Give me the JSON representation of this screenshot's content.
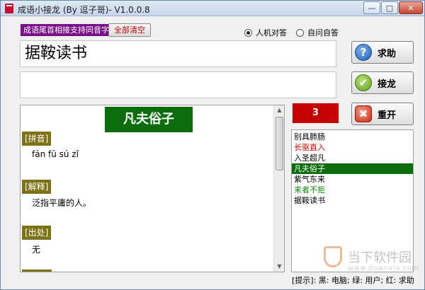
{
  "window": {
    "title": "成语小接龙 (By 逗子哥)- V1.0.0.8",
    "min_glyph": "—",
    "max_glyph": "□",
    "close_glyph": "✕"
  },
  "toolbar": {
    "hint_label": "成语尾首相接支持同音字",
    "clear_label": "全部清空"
  },
  "modes": {
    "human_vs_computer": "人机对答",
    "self_play": "自问自答",
    "selected": "human_vs_computer"
  },
  "current_idiom": "据鞍读书",
  "input_value": "",
  "detail": {
    "word": "凡夫俗子",
    "pinyin_label": "[拼音]",
    "pinyin": "fán fū sú zǐ",
    "meaning_label": "[解释]",
    "meaning": "泛指平庸的人。",
    "source_label": "[出处]",
    "source": "无"
  },
  "buttons": {
    "help_label": "求助",
    "help_icon": "?",
    "accept_label": "接龙",
    "accept_icon": "✔",
    "reset_label": "重开",
    "reset_icon": "✖"
  },
  "counter": "3",
  "history": [
    {
      "text": "别具肺肠",
      "type": "computer"
    },
    {
      "text": "长驱直入",
      "type": "help"
    },
    {
      "text": "入圣超凡",
      "type": "computer"
    },
    {
      "text": "凡夫俗子",
      "type": "selected"
    },
    {
      "text": "紫气东来",
      "type": "computer"
    },
    {
      "text": "来者不拒",
      "type": "user"
    },
    {
      "text": "据鞍读书",
      "type": "computer"
    }
  ],
  "legend": "[提示]: 黑: 电脑; 绿: 用户; 红: 求助",
  "watermark": {
    "cn": "当下软件园",
    "en": "www.downxia.com"
  },
  "colors": {
    "accent_green": "#0b6d0b",
    "counter_red": "#c40000",
    "label_purple": "#7a0e8a",
    "section_olive": "#7d7216"
  }
}
